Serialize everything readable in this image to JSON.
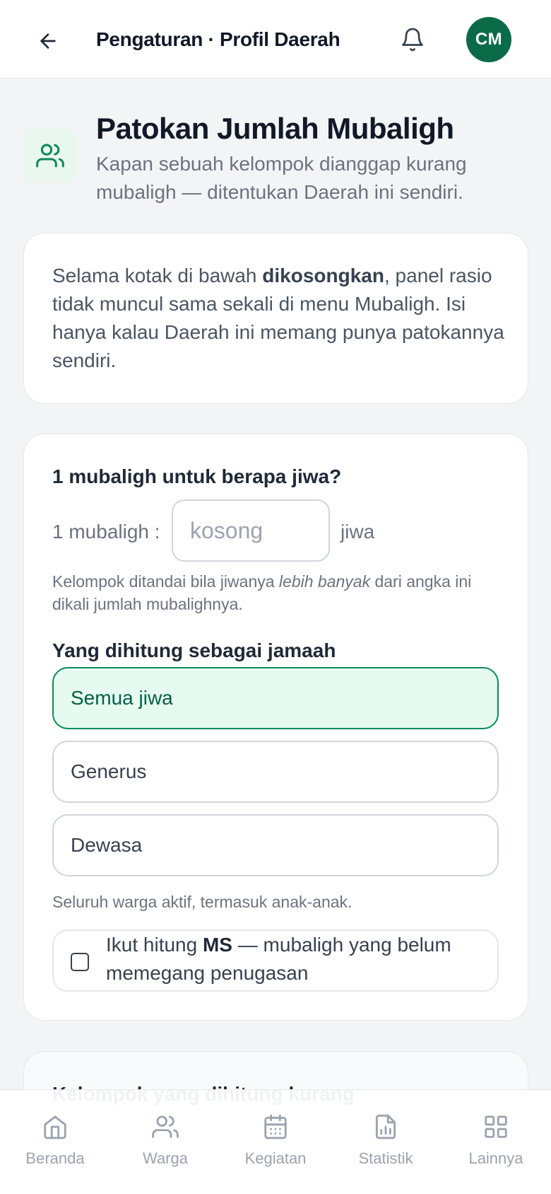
{
  "header": {
    "back_icon": "arrow-left-icon",
    "title": "Pengaturan · Profil Daerah",
    "bell_icon": "bell-icon",
    "avatar_initials": "CM",
    "avatar_color": "#0b6b48"
  },
  "section": {
    "icon": "users-icon",
    "title": "Patokan Jumlah Mubaligh",
    "subtitle": "Kapan sebuah kelompok dianggap kurang mubaligh — ditentukan Daerah ini sendiri."
  },
  "info": {
    "text_before": "Selama kotak di bawah ",
    "text_bold": "dikosongkan",
    "text_after": ", panel rasio tidak muncul sama sekali di menu Mubaligh. Isi hanya kalau Daerah ini memang punya patokannya sendiri."
  },
  "form": {
    "question": "1 mubaligh untuk berapa jiwa?",
    "ratio_prefix": "1 mubaligh :",
    "ratio_value": "",
    "ratio_placeholder": "kosong",
    "ratio_suffix": "jiwa",
    "helper_before": "Kelompok ditandai bila jiwanya ",
    "helper_italic": "lebih banyak",
    "helper_after": " dari angka ini dikali jumlah mubalighnya.",
    "group_label": "Yang dihitung sebagai jamaah",
    "options": [
      {
        "label": "Semua jiwa",
        "selected": true
      },
      {
        "label": "Generus",
        "selected": false
      },
      {
        "label": "Dewasa",
        "selected": false
      }
    ],
    "option_help": "Seluruh warga aktif, termasuk anak-anak.",
    "ms_checked": false,
    "ms_before": "Ikut hitung ",
    "ms_bold": "MS",
    "ms_after": " — mubaligh yang belum memegang penugasan"
  },
  "next_card": {
    "title": "Kelompok yang dihitung kurang"
  },
  "nav": {
    "items": [
      {
        "label": "Beranda",
        "icon": "home-icon"
      },
      {
        "label": "Warga",
        "icon": "users-icon"
      },
      {
        "label": "Kegiatan",
        "icon": "calendar-icon"
      },
      {
        "label": "Statistik",
        "icon": "chart-icon"
      },
      {
        "label": "Lainnya",
        "icon": "grid-icon"
      }
    ]
  },
  "colors": {
    "accent": "#0b8a5a",
    "accent_bg": "#e6faf0"
  }
}
